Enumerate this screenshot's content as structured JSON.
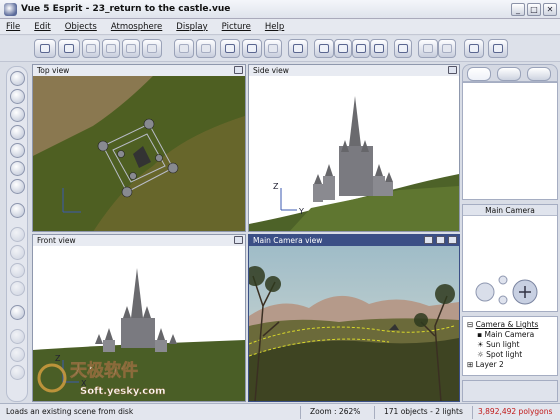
{
  "window": {
    "title": "Vue 5 Esprit - 23_return to the castle.vue"
  },
  "menu": [
    "File",
    "Edit",
    "Objects",
    "Atmosphere",
    "Display",
    "Picture",
    "Help"
  ],
  "viewports": {
    "top": {
      "label": "Top view"
    },
    "side": {
      "label": "Side view"
    },
    "front": {
      "label": "Front view"
    },
    "camera": {
      "label": "Main Camera view"
    }
  },
  "axes": {
    "z": "Z",
    "y": "Y",
    "x": "X"
  },
  "right_panel": {
    "camera_header": "Main Camera",
    "tree": [
      "Camera & Lights",
      "Main Camera",
      "Sun light",
      "Spot light",
      "Layer 2"
    ]
  },
  "status": {
    "message": "Loads an existing scene from disk",
    "zoom": "Zoom : 262%",
    "objects": "171 objects - 2 lights",
    "polygons": "3,892,492 polygons"
  },
  "watermark": {
    "line1": "天极软件",
    "line2": "Soft.yesky.com"
  },
  "colors": {
    "accent": "#3b4f86",
    "polygons": "#c01818",
    "grass": "#5a6a2a"
  }
}
